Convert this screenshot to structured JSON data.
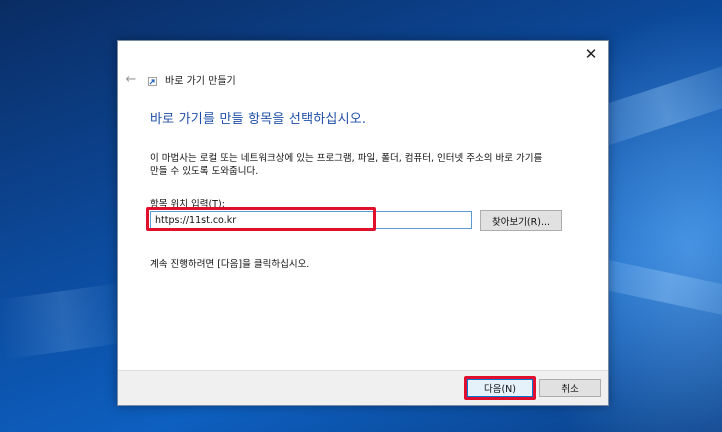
{
  "window": {
    "title": "바로 가기 만들기",
    "close_glyph": "✕",
    "back_glyph": "←"
  },
  "main": {
    "heading": "바로 가기를 만들 항목을 선택하십시오.",
    "description_line1": "이 마법사는 로컬 또는 네트워크상에 있는 프로그램, 파일, 폴더, 컴퓨터, 인터넷 주소의 바로 가기를",
    "description_line2": "만들 수 있도록 도와줍니다.",
    "location_label": "항목 위치 입력(T):",
    "location_value": "https://11st.co.kr",
    "browse_label": "찾아보기(R)...",
    "continue_text": "계속 진행하려면 [다음]을 클릭하십시오."
  },
  "footer": {
    "next_label": "다음(N)",
    "cancel_label": "취소"
  },
  "colors": {
    "heading": "#1f4fa8",
    "highlight": "#e0102c",
    "focus_border": "#5a9bd5"
  },
  "icons": {
    "back": "back-arrow-icon",
    "close": "close-icon",
    "shortcut": "shortcut-arrow-icon"
  }
}
